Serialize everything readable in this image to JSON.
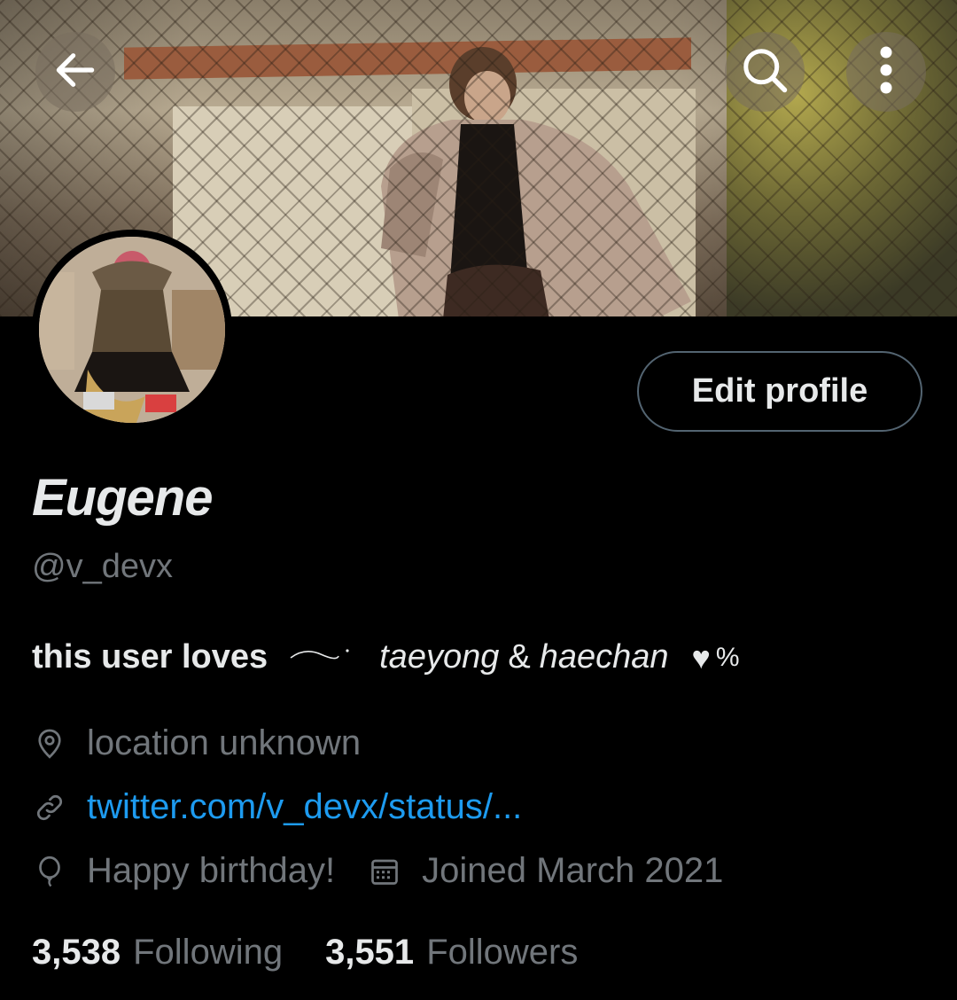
{
  "header": {
    "back_icon": "arrow-left-icon",
    "search_icon": "search-icon",
    "more_icon": "more-vertical-icon"
  },
  "profile": {
    "display_name": "Eugene",
    "handle": "@v_devx",
    "edit_button_label": "Edit profile",
    "bio": {
      "part1": "this user loves",
      "part2": "taeyong",
      "amp": "&",
      "part3": "haechan",
      "heart": "♥",
      "suffix": "%"
    },
    "location": "location unknown",
    "url": "twitter.com/v_devx/status/...",
    "birthday": "Happy birthday!",
    "joined": "Joined March 2021"
  },
  "stats": {
    "following_count": "3,538",
    "following_label": "Following",
    "followers_count": "3,551",
    "followers_label": "Followers"
  },
  "colors": {
    "background": "#000000",
    "text_primary": "#e7e9ea",
    "text_secondary": "#71767b",
    "link": "#1d9bf0",
    "button_border": "#536471"
  }
}
